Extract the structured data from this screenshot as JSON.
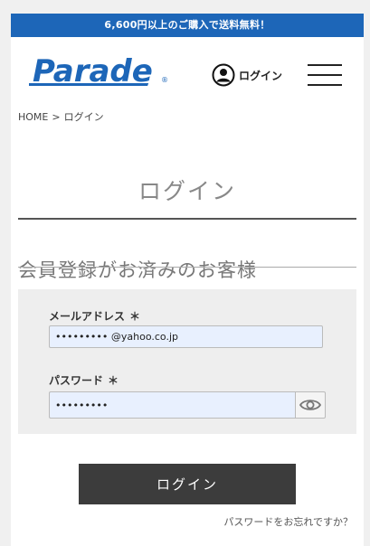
{
  "promo": {
    "text": "6,600円以上のご購入で送料無料！"
  },
  "colors": {
    "promo_bar": "#1d66b8",
    "logo": "#1d66b8",
    "login_button": "#3c3c3c",
    "input_autofill": "#e8f0fe"
  },
  "header": {
    "logo_text": "Parade",
    "logo_mark": "®",
    "login_label": "ログイン",
    "login_icon": "user-circle-icon",
    "menu_icon": "hamburger-menu-icon"
  },
  "breadcrumb": {
    "home": "HOME",
    "separator": ">",
    "current": "ログイン"
  },
  "page_title": "ログイン",
  "section_title": "会員登録がお済みのお客様",
  "form": {
    "email_label": "メールアドレス",
    "email_value": "••••••••• @yahoo.co.jp",
    "password_label": "パスワード",
    "password_value": "•••••••••",
    "required_mark": "＊",
    "toggle_icon": "eye-icon"
  },
  "login_button_label": "ログイン",
  "forgot_password": "パスワードをお忘れですか？"
}
